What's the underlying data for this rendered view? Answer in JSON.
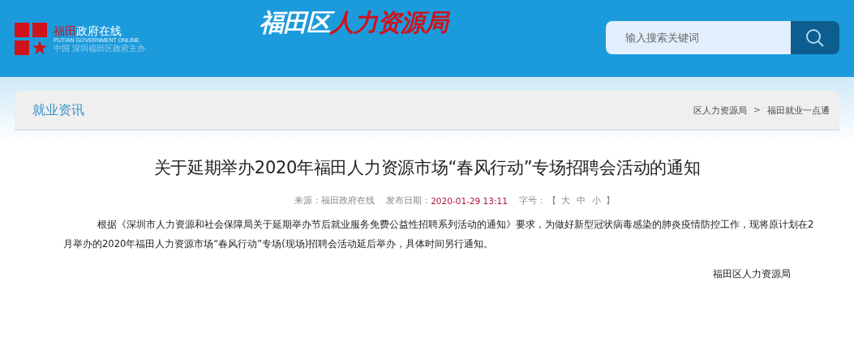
{
  "header": {
    "logo": {
      "name_part1": "福田",
      "name_part2": "政府在线",
      "english": "PUTIAN GOVERNMENT ONLINE",
      "tagline": "中国 深圳福田区政府主办"
    },
    "site_title": {
      "part1": "福田区",
      "part2": "人力资源局"
    },
    "search": {
      "placeholder": "输入搜索关键词"
    }
  },
  "section": {
    "title": "就业资讯",
    "breadcrumb": [
      {
        "label": "区人力资源局"
      },
      {
        "label": ">",
        "kind": "separator"
      },
      {
        "label": "福田就业一点通"
      }
    ]
  },
  "article": {
    "title": "关于延期举办2020年福田人力资源市场“春风行动”专场招聘会活动的通知",
    "meta": {
      "source_label": "来源：",
      "source": "福田政府在线",
      "date_label": "发布日期：",
      "date": "2020-01-29 13:11",
      "size_label": "字号：",
      "size_open": "【",
      "sizes": [
        "大",
        "中",
        "小"
      ],
      "size_close": "】"
    },
    "body": "根据《深圳市人力资源和社会保障局关于延期举办节后就业服务免费公益性招聘系列活动的通知》要求，为做好新型冠状病毒感染的肺炎疫情防控工作，现将原计划在2月举办的2020年福田人力资源市场“春风行动”专场(现场)招聘会活动延后举办，具体时间另行通知。",
    "signature": "福田区人力资源局"
  }
}
